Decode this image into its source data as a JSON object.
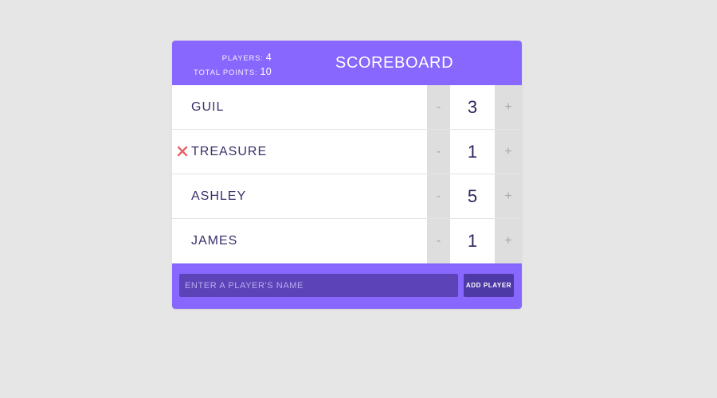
{
  "header": {
    "title": "SCOREBOARD",
    "stats": {
      "players_label": "PLAYERS:",
      "players_value": "4",
      "total_points_label": "TOTAL POINTS:",
      "total_points_value": "10"
    }
  },
  "players": [
    {
      "name": "GUIL",
      "score": "3",
      "decrement_label": "-",
      "increment_label": "+",
      "show_remove": false
    },
    {
      "name": "TREASURE",
      "score": "1",
      "decrement_label": "-",
      "increment_label": "+",
      "show_remove": true
    },
    {
      "name": "ASHLEY",
      "score": "5",
      "decrement_label": "-",
      "increment_label": "+",
      "show_remove": false
    },
    {
      "name": "JAMES",
      "score": "1",
      "decrement_label": "-",
      "increment_label": "+",
      "show_remove": false
    }
  ],
  "add_player_form": {
    "input_value": "",
    "input_placeholder": "ENTER A PLAYER'S NAME",
    "button_label": "ADD PLAYER"
  },
  "icons": {
    "remove": "close-icon"
  },
  "colors": {
    "page_background": "#e6e6e6",
    "accent": "#8767fd",
    "input_background": "#5c44b8",
    "button_background": "#4e3aa7",
    "counter_background": "#dedede",
    "remove_icon": "#e8626a",
    "text_dark": "#3b2f6a"
  }
}
